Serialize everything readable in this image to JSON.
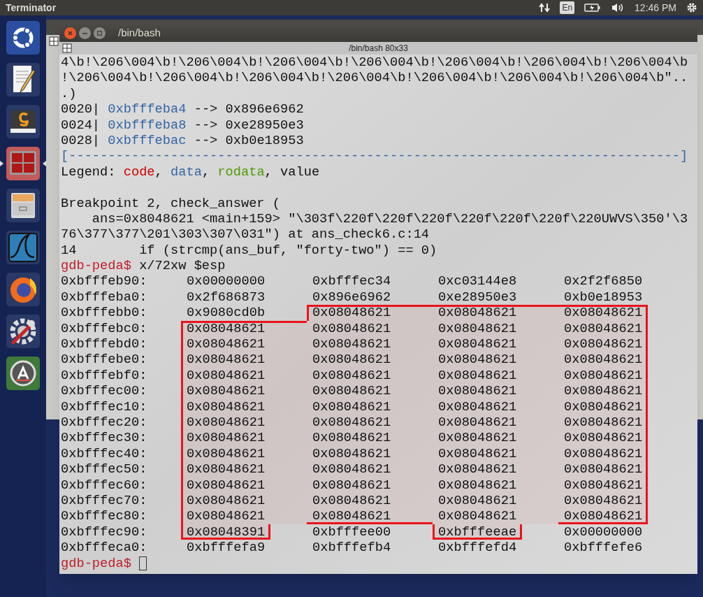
{
  "top_panel": {
    "app_name": "Terminator",
    "keyboard_layout": "En",
    "clock": "12:46 PM"
  },
  "launcher": {
    "items": [
      {
        "kind": "ubuntu",
        "active": false
      },
      {
        "kind": "editor",
        "active": false
      },
      {
        "kind": "sublime",
        "active": false
      },
      {
        "kind": "terminator",
        "active": true
      },
      {
        "kind": "files",
        "active": false
      },
      {
        "kind": "wireshark",
        "active": false
      },
      {
        "kind": "firefox",
        "active": false
      },
      {
        "kind": "settings",
        "active": false
      },
      {
        "kind": "updater",
        "active": false
      }
    ]
  },
  "window": {
    "title": "/bin/bash",
    "tab_title": "/bin/bash 80x33"
  },
  "terminal": {
    "lines": [
      {
        "segments": [
          {
            "text": "4\\b!\\206\\004\\b!\\206\\004\\b!\\206\\004\\b!\\206\\004\\b!\\206\\004\\b!\\206\\004\\b!\\206\\004\\b",
            "kind": "plain"
          }
        ]
      },
      {
        "segments": [
          {
            "text": "!\\206\\004\\b!\\206\\004\\b!\\206\\004\\b!\\206\\004\\b!\\206\\004\\b!\\206\\004\\b!\\206\\004\\b\"..",
            "kind": "plain"
          }
        ]
      },
      {
        "segments": [
          {
            "text": ".)",
            "kind": "plain"
          }
        ]
      },
      {
        "segments": [
          {
            "text": "0020| ",
            "kind": "plain"
          },
          {
            "text": "0xbfffeba4",
            "kind": "data"
          },
          {
            "text": " --> 0x896e6962",
            "kind": "plain"
          }
        ]
      },
      {
        "segments": [
          {
            "text": "0024| ",
            "kind": "plain"
          },
          {
            "text": "0xbfffeba8",
            "kind": "data"
          },
          {
            "text": " --> 0xe28950e3",
            "kind": "plain"
          }
        ]
      },
      {
        "segments": [
          {
            "text": "0028| ",
            "kind": "plain"
          },
          {
            "text": "0xbfffebac",
            "kind": "data"
          },
          {
            "text": " --> 0xb0e18953",
            "kind": "plain"
          }
        ]
      },
      {
        "segments": [
          {
            "text": "[------------------------------------------------------------------------------]",
            "kind": "data"
          }
        ]
      },
      {
        "segments": [
          {
            "text": "Legend: ",
            "kind": "plain"
          },
          {
            "text": "code",
            "kind": "code"
          },
          {
            "text": ", ",
            "kind": "plain"
          },
          {
            "text": "data",
            "kind": "data"
          },
          {
            "text": ", ",
            "kind": "plain"
          },
          {
            "text": "rodata",
            "kind": "rodata"
          },
          {
            "text": ", value",
            "kind": "plain"
          }
        ]
      },
      {
        "kind": "blank"
      },
      {
        "segments": [
          {
            "text": "Breakpoint 2, check_answer (",
            "kind": "plain"
          }
        ]
      },
      {
        "segments": [
          {
            "text": "    ans=0x8048621 <main+159> \"\\303f\\220f\\220f\\220f\\220f\\220f\\220f\\220UWVS\\350'\\3",
            "kind": "plain"
          }
        ]
      },
      {
        "segments": [
          {
            "text": "76\\377\\377\\201\\303\\307\\031\") at ans_check6.c:14",
            "kind": "plain"
          }
        ]
      },
      {
        "segments": [
          {
            "text": "14        if (strcmp(ans_buf, \"forty-two\") == 0)",
            "kind": "plain"
          }
        ]
      },
      {
        "segments": [
          {
            "text": "gdb-peda$",
            "kind": "prompt"
          },
          {
            "text": " x/72xw $esp",
            "kind": "plain"
          }
        ]
      }
    ],
    "dump": {
      "rows": [
        {
          "address": "0xbfffeb90:",
          "cells": [
            {
              "text": "0x00000000",
              "boxed": false
            },
            {
              "text": "0xbfffec34",
              "boxed": false
            },
            {
              "text": "0xc03144e8",
              "boxed": false
            },
            {
              "text": "0x2f2f6850",
              "boxed": false
            }
          ]
        },
        {
          "address": "0xbfffeba0:",
          "cells": [
            {
              "text": "0x2f686873",
              "boxed": false
            },
            {
              "text": "0x896e6962",
              "boxed": false
            },
            {
              "text": "0xe28950e3",
              "boxed": false
            },
            {
              "text": "0xb0e18953",
              "boxed": false
            }
          ]
        },
        {
          "address": "0xbfffebb0:",
          "cells": [
            {
              "text": "0x9080cd0b",
              "boxed": false
            },
            {
              "text": "0x08048621",
              "boxed": true
            },
            {
              "text": "0x08048621",
              "boxed": true
            },
            {
              "text": "0x08048621",
              "boxed": true
            }
          ]
        },
        {
          "address": "0xbfffebc0:",
          "cells": [
            {
              "text": "0x08048621",
              "boxed": true
            },
            {
              "text": "0x08048621",
              "boxed": true
            },
            {
              "text": "0x08048621",
              "boxed": true
            },
            {
              "text": "0x08048621",
              "boxed": true
            }
          ]
        },
        {
          "address": "0xbfffebd0:",
          "cells": [
            {
              "text": "0x08048621",
              "boxed": true
            },
            {
              "text": "0x08048621",
              "boxed": true
            },
            {
              "text": "0x08048621",
              "boxed": true
            },
            {
              "text": "0x08048621",
              "boxed": true
            }
          ]
        },
        {
          "address": "0xbfffebe0:",
          "cells": [
            {
              "text": "0x08048621",
              "boxed": true
            },
            {
              "text": "0x08048621",
              "boxed": true
            },
            {
              "text": "0x08048621",
              "boxed": true
            },
            {
              "text": "0x08048621",
              "boxed": true
            }
          ]
        },
        {
          "address": "0xbfffebf0:",
          "cells": [
            {
              "text": "0x08048621",
              "boxed": true
            },
            {
              "text": "0x08048621",
              "boxed": true
            },
            {
              "text": "0x08048621",
              "boxed": true
            },
            {
              "text": "0x08048621",
              "boxed": true
            }
          ]
        },
        {
          "address": "0xbfffec00:",
          "cells": [
            {
              "text": "0x08048621",
              "boxed": true
            },
            {
              "text": "0x08048621",
              "boxed": true
            },
            {
              "text": "0x08048621",
              "boxed": true
            },
            {
              "text": "0x08048621",
              "boxed": true
            }
          ]
        },
        {
          "address": "0xbfffec10:",
          "cells": [
            {
              "text": "0x08048621",
              "boxed": true
            },
            {
              "text": "0x08048621",
              "boxed": true
            },
            {
              "text": "0x08048621",
              "boxed": true
            },
            {
              "text": "0x08048621",
              "boxed": true
            }
          ]
        },
        {
          "address": "0xbfffec20:",
          "cells": [
            {
              "text": "0x08048621",
              "boxed": true
            },
            {
              "text": "0x08048621",
              "boxed": true
            },
            {
              "text": "0x08048621",
              "boxed": true
            },
            {
              "text": "0x08048621",
              "boxed": true
            }
          ]
        },
        {
          "address": "0xbfffec30:",
          "cells": [
            {
              "text": "0x08048621",
              "boxed": true
            },
            {
              "text": "0x08048621",
              "boxed": true
            },
            {
              "text": "0x08048621",
              "boxed": true
            },
            {
              "text": "0x08048621",
              "boxed": true
            }
          ]
        },
        {
          "address": "0xbfffec40:",
          "cells": [
            {
              "text": "0x08048621",
              "boxed": true
            },
            {
              "text": "0x08048621",
              "boxed": true
            },
            {
              "text": "0x08048621",
              "boxed": true
            },
            {
              "text": "0x08048621",
              "boxed": true
            }
          ]
        },
        {
          "address": "0xbfffec50:",
          "cells": [
            {
              "text": "0x08048621",
              "boxed": true
            },
            {
              "text": "0x08048621",
              "boxed": true
            },
            {
              "text": "0x08048621",
              "boxed": true
            },
            {
              "text": "0x08048621",
              "boxed": true
            }
          ]
        },
        {
          "address": "0xbfffec60:",
          "cells": [
            {
              "text": "0x08048621",
              "boxed": true
            },
            {
              "text": "0x08048621",
              "boxed": true
            },
            {
              "text": "0x08048621",
              "boxed": true
            },
            {
              "text": "0x08048621",
              "boxed": true
            }
          ]
        },
        {
          "address": "0xbfffec70:",
          "cells": [
            {
              "text": "0x08048621",
              "boxed": true
            },
            {
              "text": "0x08048621",
              "boxed": true
            },
            {
              "text": "0x08048621",
              "boxed": true
            },
            {
              "text": "0x08048621",
              "boxed": true
            }
          ]
        },
        {
          "address": "0xbfffec80:",
          "cells": [
            {
              "text": "0x08048621",
              "boxed": true
            },
            {
              "text": "0x08048621",
              "boxed": true
            },
            {
              "text": "0x08048621",
              "boxed": true
            },
            {
              "text": "0x08048621",
              "boxed": true
            }
          ]
        },
        {
          "address": "0xbfffec90:",
          "cells": [
            {
              "text": "0x08048391",
              "boxed": true
            },
            {
              "text": "0xbfffee00",
              "boxed": false
            },
            {
              "text": "0xbfffeeae",
              "boxed": true
            },
            {
              "text": "0x00000000",
              "boxed": false
            }
          ]
        },
        {
          "address": "0xbfffeca0:",
          "cells": [
            {
              "text": "0xbfffefa9",
              "boxed": false
            },
            {
              "text": "0xbfffefb4",
              "boxed": false
            },
            {
              "text": "0xbfffefd4",
              "boxed": false
            },
            {
              "text": "0xbfffefe6",
              "boxed": false
            }
          ]
        }
      ]
    },
    "prompt": "gdb-peda$"
  }
}
